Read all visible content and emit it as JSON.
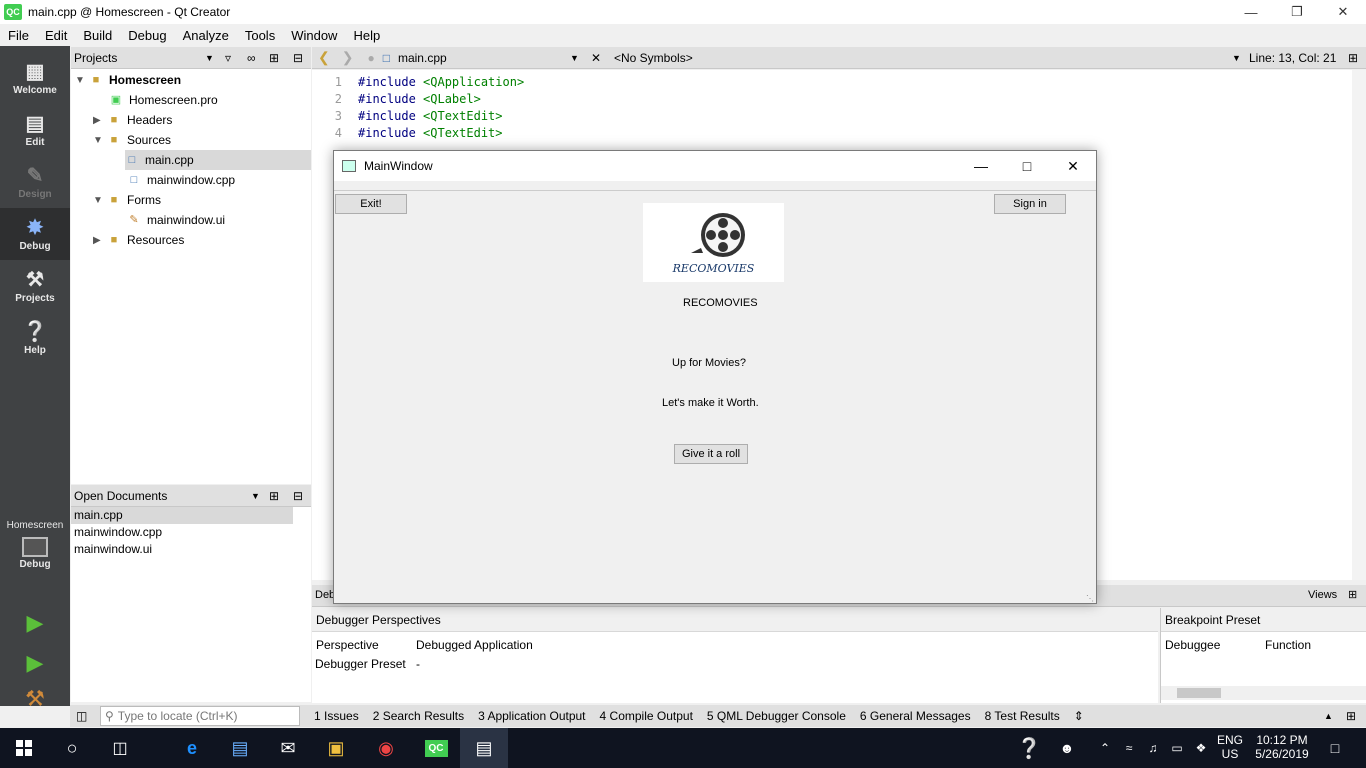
{
  "window": {
    "title": "main.cpp @ Homescreen - Qt Creator",
    "logo": "QC"
  },
  "menu": [
    "File",
    "Edit",
    "Build",
    "Debug",
    "Analyze",
    "Tools",
    "Window",
    "Help"
  ],
  "modes": [
    {
      "label": "Welcome",
      "icon": "grid-icon"
    },
    {
      "label": "Edit",
      "icon": "document-icon"
    },
    {
      "label": "Design",
      "icon": "pen-icon"
    },
    {
      "label": "Debug",
      "icon": "bug-icon"
    },
    {
      "label": "Projects",
      "icon": "wrench-icon"
    },
    {
      "label": "Help",
      "icon": "help-icon"
    }
  ],
  "target": {
    "project": "Homescreen",
    "config": "Debug"
  },
  "projects_pane": {
    "title": "Projects",
    "tree": [
      {
        "label": "Homescreen"
      },
      {
        "label": "Homescreen.pro"
      },
      {
        "label": "Headers"
      },
      {
        "label": "Sources"
      },
      {
        "label": "main.cpp"
      },
      {
        "label": "mainwindow.cpp"
      },
      {
        "label": "Forms"
      },
      {
        "label": "mainwindow.ui"
      },
      {
        "label": "Resources"
      }
    ]
  },
  "open_documents": {
    "title": "Open Documents",
    "items": [
      "main.cpp",
      "mainwindow.cpp",
      "mainwindow.ui"
    ]
  },
  "editor": {
    "file": "main.cpp",
    "symbols": "<No Symbols>",
    "position": "Line: 13, Col: 21",
    "lines": [
      {
        "n": "1",
        "kw": "#include",
        "inc": " <QApplication>"
      },
      {
        "n": "2",
        "kw": "#include",
        "inc": " <QLabel>"
      },
      {
        "n": "3",
        "kw": "#include",
        "inc": " <QTextEdit>"
      },
      {
        "n": "4",
        "kw": "#include",
        "inc": " <QTextEdit>"
      }
    ]
  },
  "debugger": {
    "header_partial": "Deb",
    "views_label": "Views",
    "perspectives_title": "Debugger Perspectives",
    "perspective_label": "Perspective",
    "perspective_value": "Debugged Application",
    "preset_label": "Debugger Preset",
    "preset_value": "-",
    "breakpoint_title": "Breakpoint Preset",
    "col_debuggee": "Debuggee",
    "col_function": "Function"
  },
  "statusbar": {
    "locator_placeholder": "Type to locate (Ctrl+K)",
    "tabs": [
      "1  Issues",
      "2  Search Results",
      "3  Application Output",
      "4  Compile Output",
      "5  QML Debugger Console",
      "6  General Messages",
      "8  Test Results"
    ]
  },
  "app_window": {
    "title": "MainWindow",
    "exit_button": "Exit!",
    "signin_button": "Sign in",
    "logo_text": "RECOMOVIES",
    "app_name": "RECOMOVIES",
    "tagline1": "Up for Movies?",
    "tagline2": "Let's make it Worth.",
    "roll_button": "Give it a roll"
  },
  "taskbar": {
    "lang_top": "ENG",
    "lang_bottom": "US",
    "time": "10:12 PM",
    "date": "5/26/2019"
  }
}
